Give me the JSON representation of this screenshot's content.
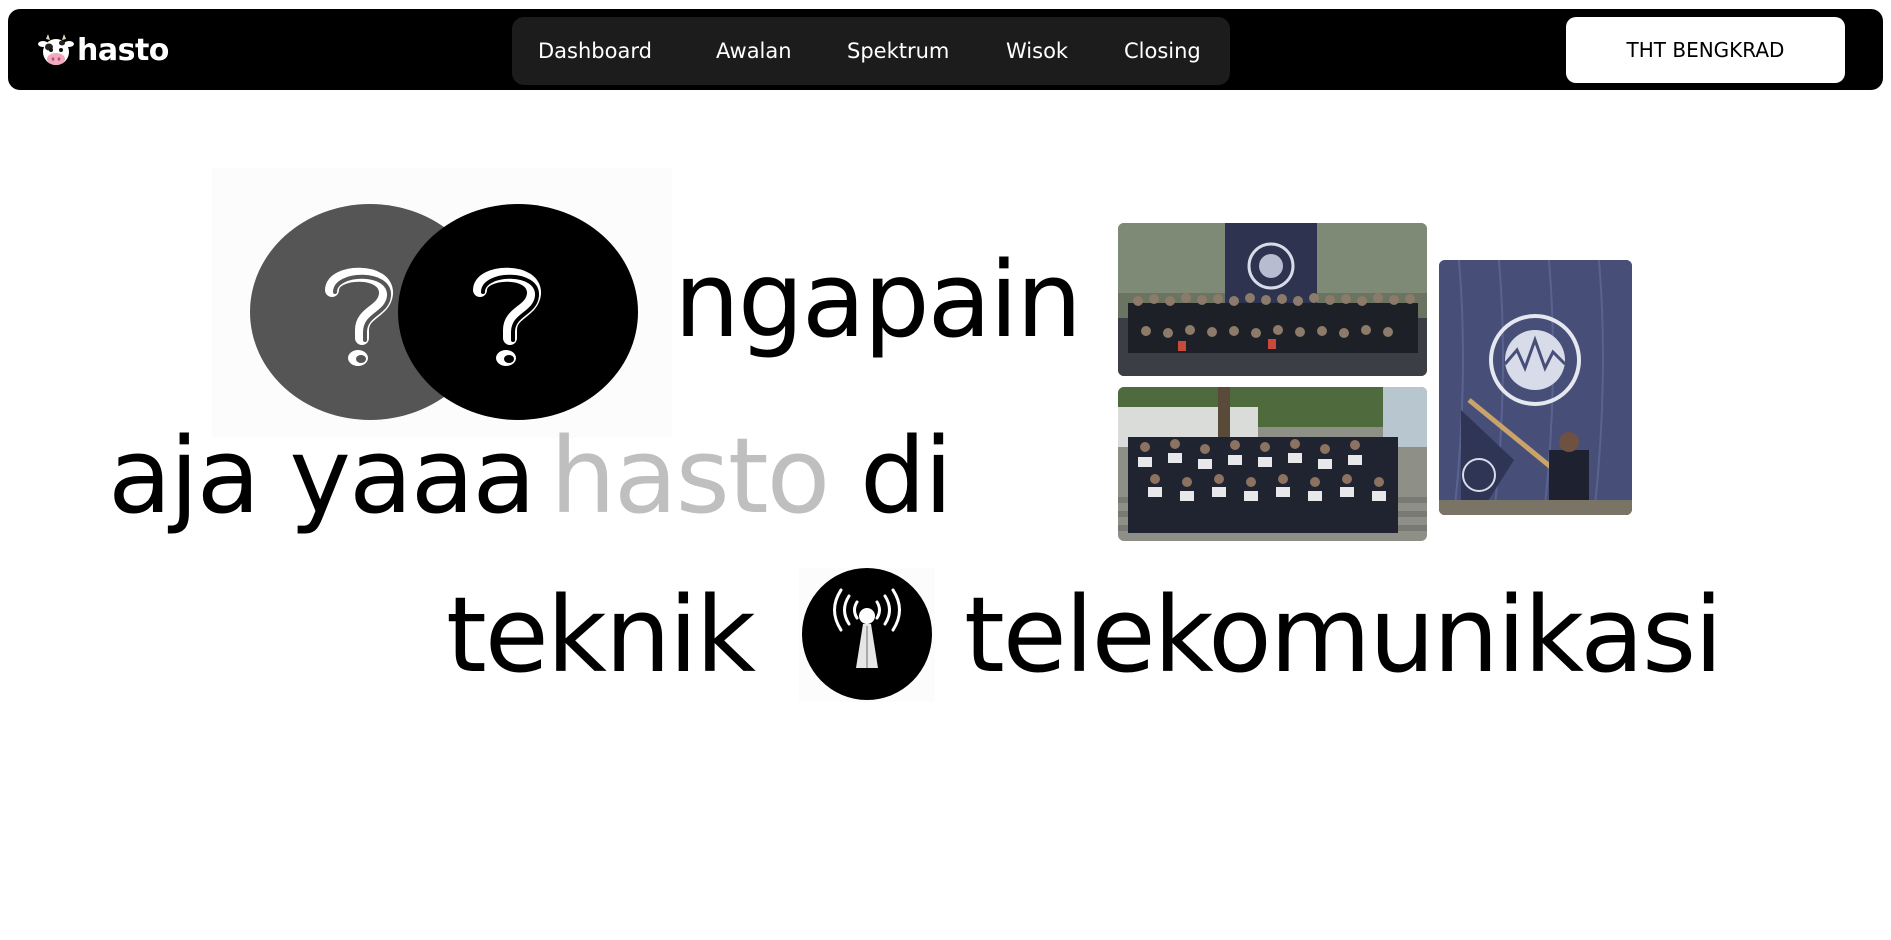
{
  "brand": {
    "name": "hasto",
    "icon": "cow-icon"
  },
  "nav": {
    "items": [
      {
        "label": "Dashboard"
      },
      {
        "label": "Awalan"
      },
      {
        "label": "Spektrum"
      },
      {
        "label": "Wisok"
      },
      {
        "label": "Closing"
      }
    ],
    "cta_label": "THT BENGKRAD"
  },
  "hero": {
    "line1": {
      "word": "ngapain",
      "icon": "question-mark-icon"
    },
    "line2": {
      "word1": "aja yaaa",
      "highlight": "hasto",
      "word2": "di"
    },
    "line3": {
      "word1": "teknik",
      "icon": "antenna-icon",
      "word2": "telekomunikasi"
    },
    "photos": [
      {
        "name": "group-photo-banner"
      },
      {
        "name": "group-photo-stairs"
      },
      {
        "name": "flag-photo"
      }
    ]
  },
  "colors": {
    "navbar_bg": "#000000",
    "nav_pill_bg": "#1c1c1c",
    "highlight_text": "#bfbfbf",
    "accent_grey_circle": "#555555"
  }
}
